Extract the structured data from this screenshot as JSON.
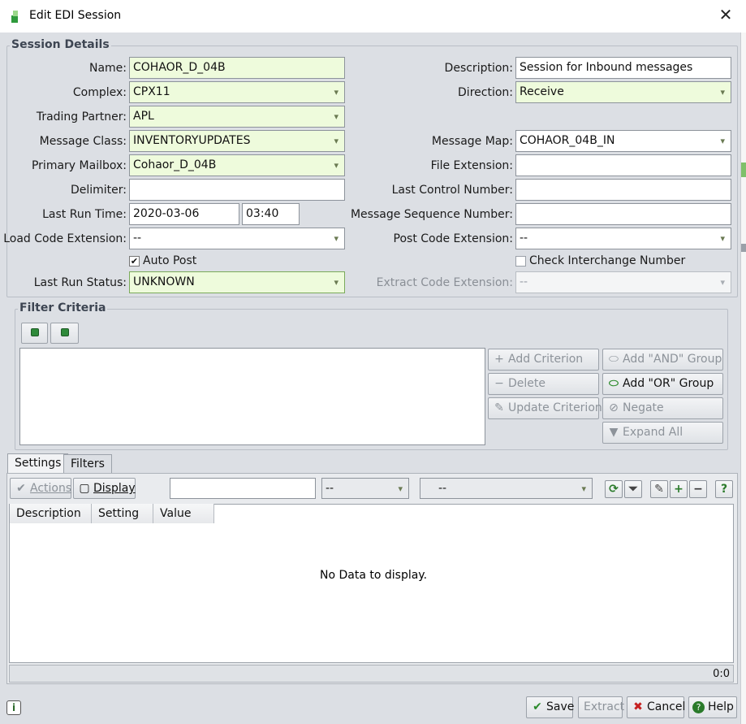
{
  "window": {
    "title": "Edit EDI Session"
  },
  "session_details": {
    "legend": "Session Details",
    "name": {
      "label": "Name:",
      "value": "COHAOR_D_04B"
    },
    "complex": {
      "label": "Complex:",
      "value": "CPX11"
    },
    "trading_partner": {
      "label": "Trading Partner:",
      "value": "APL"
    },
    "message_class": {
      "label": "Message Class:",
      "value": "INVENTORYUPDATES"
    },
    "primary_mailbox": {
      "label": "Primary Mailbox:",
      "value": "Cohaor_D_04B"
    },
    "delimiter": {
      "label": "Delimiter:",
      "value": ""
    },
    "last_run_time": {
      "label": "Last Run Time:",
      "date": "2020-03-06",
      "time": "03:40"
    },
    "load_code_extension": {
      "label": "Load Code Extension:",
      "value": "--"
    },
    "auto_post": {
      "label": "Auto Post",
      "checked_mark": "✔"
    },
    "last_run_status": {
      "label": "Last Run Status:",
      "value": "UNKNOWN"
    },
    "description": {
      "label": "Description:",
      "value": "Session for Inbound messages"
    },
    "direction": {
      "label": "Direction:",
      "value": "Receive"
    },
    "message_map": {
      "label": "Message Map:",
      "value": "COHAOR_04B_IN"
    },
    "file_extension": {
      "label": "File Extension:",
      "value": ""
    },
    "last_control_number": {
      "label": "Last Control Number:",
      "value": ""
    },
    "message_sequence_number": {
      "label": "Message Sequence Number:",
      "value": ""
    },
    "post_code_extension": {
      "label": "Post Code Extension:",
      "value": "--"
    },
    "check_interchange_number": {
      "label": "Check Interchange Number"
    },
    "extract_code_extension": {
      "label": "Extract Code Extension:",
      "value": "--"
    }
  },
  "filter_criteria": {
    "legend": "Filter Criteria",
    "add_criterion": "Add Criterion",
    "delete": "Delete",
    "update_criterion": "Update Criterion",
    "add_and_group": "Add \"AND\" Group",
    "add_or_group": "Add \"OR\" Group",
    "negate": "Negate",
    "expand_all": "Expand All"
  },
  "tabs": [
    {
      "label": "Settings"
    },
    {
      "label": "Filters"
    }
  ],
  "settings_toolbar": {
    "actions": "Actions",
    "display": "Display",
    "filter_a": "--",
    "filter_b": "--"
  },
  "grid": {
    "columns": [
      "Description",
      "Setting",
      "Value"
    ],
    "empty_message": "No Data to display.",
    "count": "0:0"
  },
  "footer": {
    "save": "Save",
    "extract": "Extract",
    "cancel": "Cancel",
    "help": "Help"
  },
  "colors": {
    "required_bg": "#eefbdc",
    "accent_green": "#2b8a2b",
    "cancel_red": "#c62020"
  }
}
